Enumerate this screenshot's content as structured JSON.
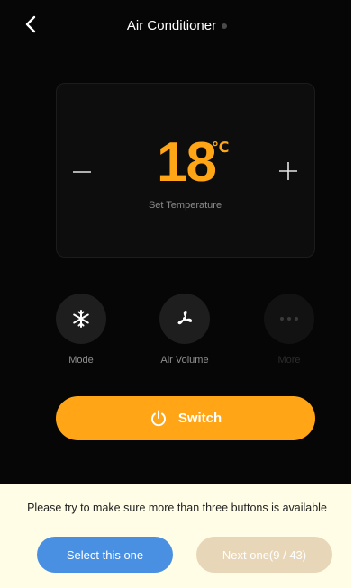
{
  "header": {
    "title": "Air Conditioner"
  },
  "temperature": {
    "value": "18",
    "unit": "℃",
    "label": "Set Temperature",
    "decrease_symbol": "−",
    "increase_symbol": "+"
  },
  "functions": [
    {
      "label": "Mode",
      "icon": "snowflake-icon"
    },
    {
      "label": "Air Volume",
      "icon": "fan-icon"
    },
    {
      "label": "More",
      "icon": "more-dots-icon"
    }
  ],
  "switch": {
    "label": "Switch",
    "icon": "power-icon"
  },
  "footer": {
    "notice": "Please try to make sure more than three buttons is available",
    "select_label": "Select this one",
    "next_label": "Next one(9 / 43)"
  },
  "colors": {
    "accent": "#ffa516",
    "select_button": "#4a90e2",
    "next_button": "#e8d6b8",
    "background": "#060606"
  }
}
